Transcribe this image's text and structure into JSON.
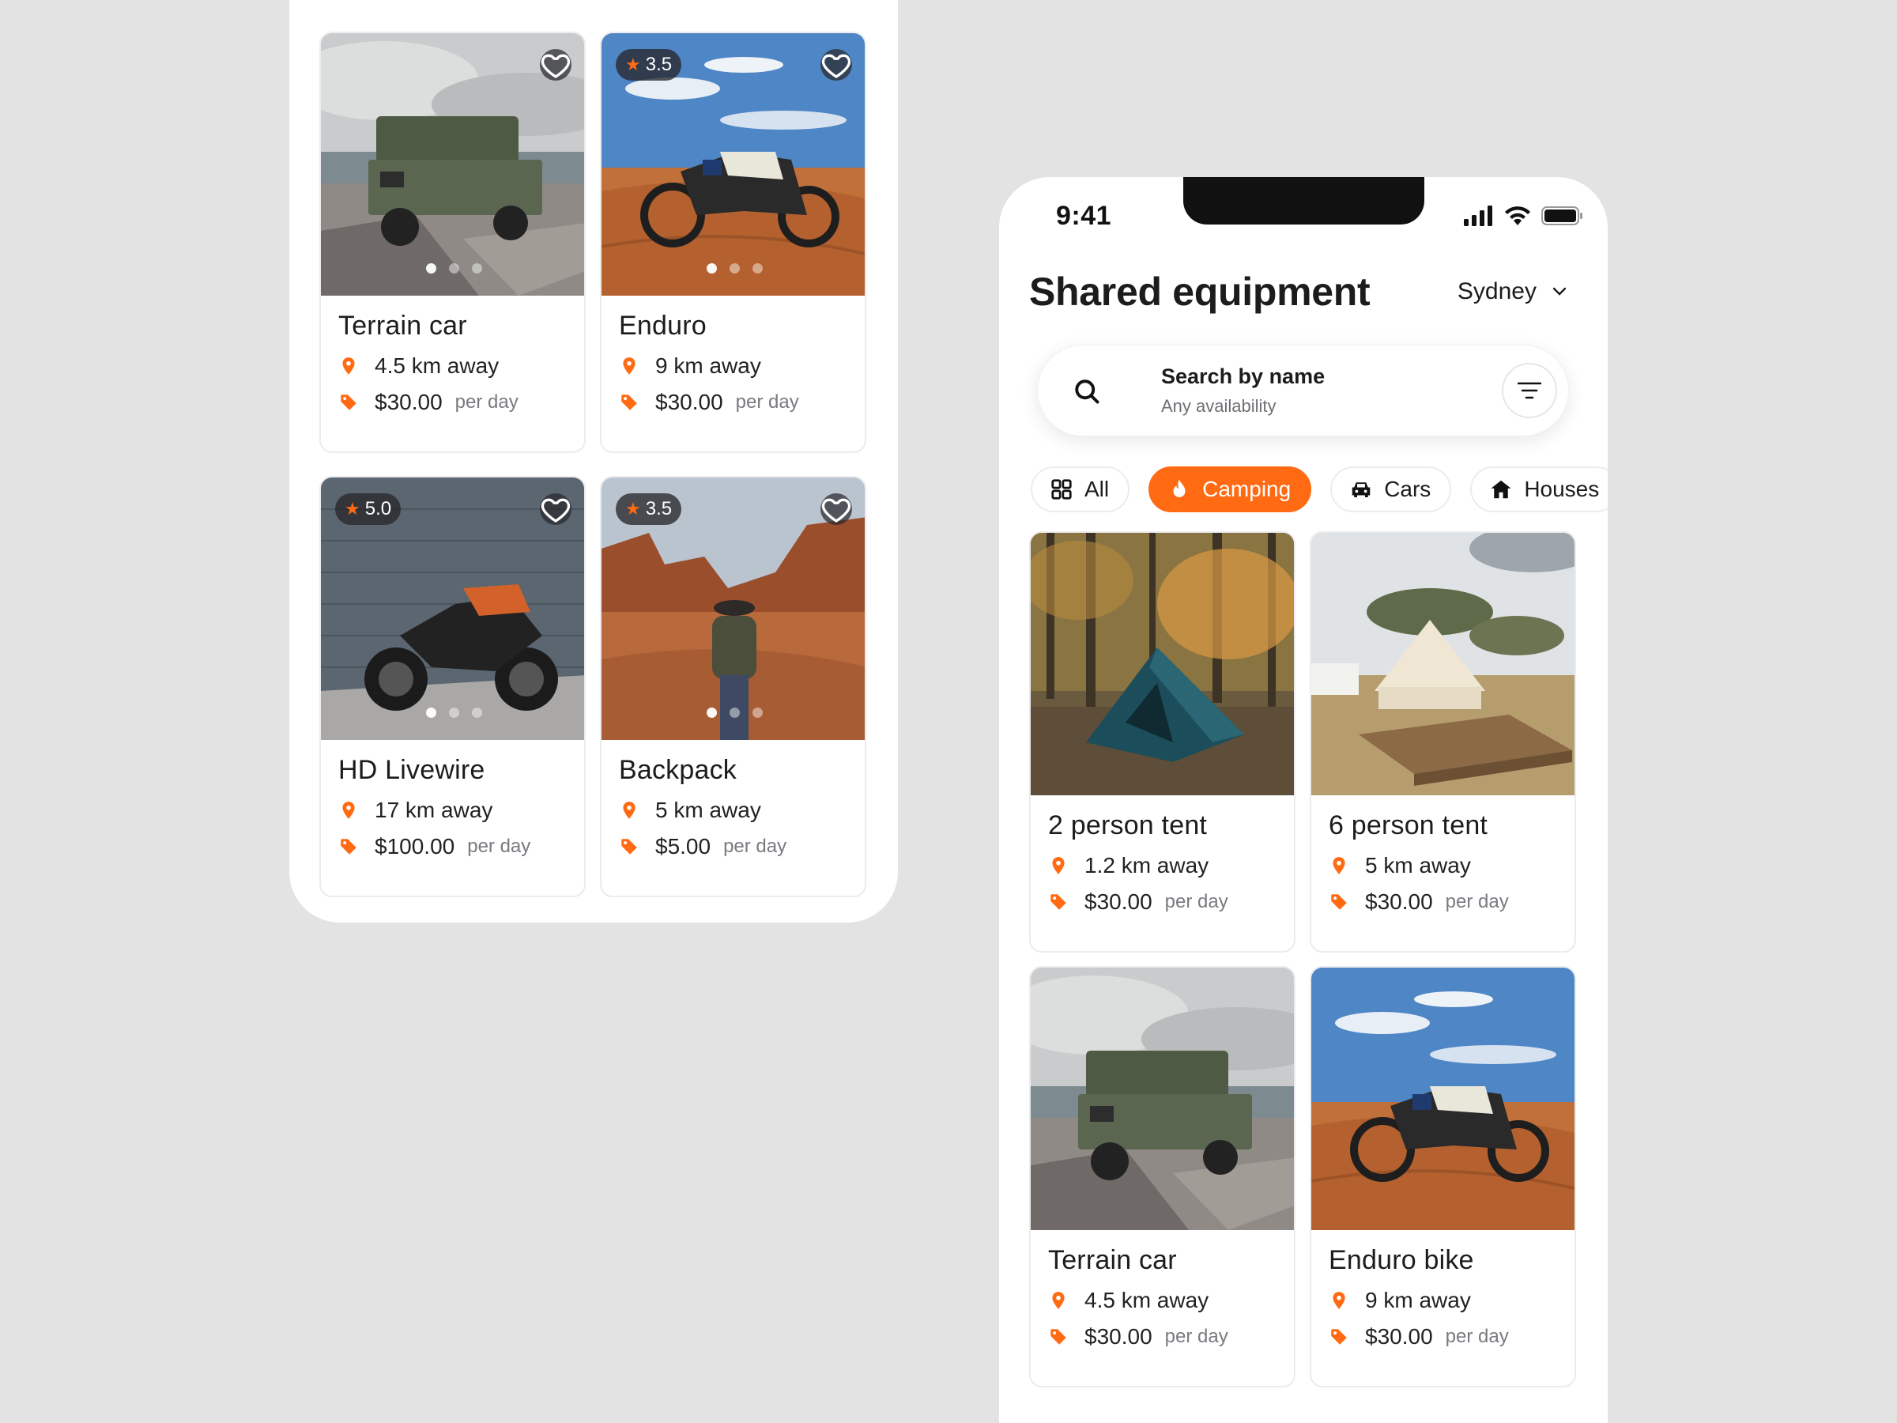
{
  "left_panel": {
    "cards": [
      {
        "title": "Terrain car",
        "distance": "4.5 km away",
        "price": "$30.00",
        "per": "per day",
        "rating": null
      },
      {
        "title": "Enduro",
        "distance": "9 km away",
        "price": "$30.00",
        "per": "per day",
        "rating": "3.5"
      },
      {
        "title": "HD Livewire",
        "distance": "17 km away",
        "price": "$100.00",
        "per": "per day",
        "rating": "5.0"
      },
      {
        "title": "Backpack",
        "distance": "5 km away",
        "price": "$5.00",
        "per": "per day",
        "rating": "3.5"
      }
    ]
  },
  "status_bar": {
    "time": "9:41"
  },
  "header": {
    "title": "Shared equipment",
    "city": "Sydney"
  },
  "search": {
    "label": "Search by name",
    "sublabel": "Any availability"
  },
  "categories": [
    {
      "label": "All",
      "icon": "grid-icon",
      "active": false
    },
    {
      "label": "Camping",
      "icon": "fire-icon",
      "active": true
    },
    {
      "label": "Cars",
      "icon": "car-icon",
      "active": false
    },
    {
      "label": "Houses",
      "icon": "house-icon",
      "active": false
    }
  ],
  "listings": [
    {
      "title": "2 person tent",
      "distance": "1.2 km away",
      "price": "$30.00",
      "per": "per day"
    },
    {
      "title": "6 person tent",
      "distance": "5 km away",
      "price": "$30.00",
      "per": "per day"
    },
    {
      "title": "Terrain car",
      "distance": "4.5 km away",
      "price": "$30.00",
      "per": "per day"
    },
    {
      "title": "Enduro bike",
      "distance": "9 km away",
      "price": "$30.00",
      "per": "per day"
    }
  ],
  "colors": {
    "accent": "#ff6a13",
    "background": "#e3e3e3",
    "text": "#1c1c1e",
    "muted": "#7a7a80"
  }
}
